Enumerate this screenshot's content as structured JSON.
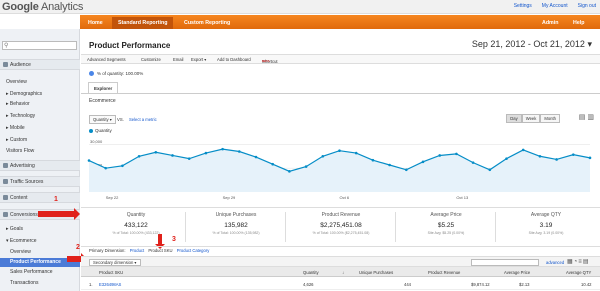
{
  "header": {
    "logo_google": "Google",
    "logo_analytics": "Analytics",
    "links": [
      "Settings",
      "My Account",
      "Sign out"
    ]
  },
  "nav": {
    "home": "Home",
    "standard_reporting": "Standard Reporting",
    "custom_reporting": "Custom Reporting",
    "admin": "Admin",
    "help": "Help"
  },
  "sidebar": {
    "audience": "Audience",
    "overview": "Overview",
    "demographics": "Demographics",
    "behavior": "Behavior",
    "technology": "Technology",
    "mobile": "Mobile",
    "custom": "Custom",
    "visitors_flow": "Visitors Flow",
    "advertising": "Advertising",
    "traffic_sources": "Traffic Sources",
    "content": "Content",
    "conversions": "Conversions",
    "goals": "Goals",
    "ecommerce": "Ecommerce",
    "ecom_overview": "Overview",
    "product_performance": "Product Performance",
    "sales_performance": "Sales Performance",
    "transactions": "Transactions"
  },
  "callouts": {
    "one": "1",
    "two": "2",
    "three": "3"
  },
  "main": {
    "title": "Product Performance",
    "date_range": "Sep 21, 2012 - Oct 21, 2012",
    "toolbar": [
      "Advanced Segments",
      "Customize",
      "Email",
      "Export ▾",
      "Add to Dashboard",
      "Shortcut"
    ],
    "shortcut_badge": "BETA",
    "segment": "% of quantity: 100.00%",
    "tab_explorer": "Explorer",
    "ecommerce": "Ecommerce",
    "metric_select": "Quantity ▾",
    "vs": "VS.",
    "select_metric": "Select a metric",
    "view_buttons": [
      "Day",
      "Week",
      "Month"
    ],
    "legend": "Quantity"
  },
  "chart_data": {
    "type": "area",
    "series": [
      {
        "name": "Quantity",
        "values": [
          19800,
          15000,
          16500,
          22500,
          25000,
          23000,
          21000,
          24500,
          27000,
          25500,
          22000,
          17500,
          13000,
          16000,
          22500,
          26000,
          24500,
          20000,
          17000,
          14000,
          19000,
          23000,
          24000,
          18500,
          14000,
          21000,
          26500,
          22500,
          20500,
          23500,
          21500
        ]
      }
    ],
    "x_ticks": [
      "Sep 22",
      "Sep 29",
      "Oct 6",
      "Oct 13"
    ],
    "y_ticks": [
      "30,000",
      "15,000"
    ],
    "ylim": [
      0,
      34000
    ],
    "color": "#058dc7"
  },
  "scorecards": [
    {
      "label": "Quantity",
      "value": "433,122",
      "sub": "% of Total: 100.00% (433,122)"
    },
    {
      "label": "Unique Purchases",
      "value": "135,982",
      "sub": "% of Total: 100.00% (135,982)"
    },
    {
      "label": "Product Revenue",
      "value": "$2,275,451.08",
      "sub": "% of Total: 100.00% ($2,275,451.08)"
    },
    {
      "label": "Average Price",
      "value": "$5.25",
      "sub": "Site Avg: $5.25 (0.00%)"
    },
    {
      "label": "Average QTY",
      "value": "3.19",
      "sub": "Site Avg: 3.19 (0.00%)"
    }
  ],
  "dims": {
    "label": "Primary Dimension:",
    "product": "Product",
    "sku": "Product SKU",
    "category": "Product Category"
  },
  "table": {
    "secondary_dimension": "Secondary dimension ▾",
    "advanced": "advanced",
    "headers": [
      "Product SKU",
      "Quantity",
      "↓",
      "Unique Purchases",
      "Product Revenue",
      "Average Price",
      "Average QTY"
    ],
    "rows": [
      {
        "num": "1.",
        "sku": "E326498AS",
        "quantity": "4,626",
        "unique": "444",
        "revenue": "$9,874.12",
        "avg_price": "$2.13",
        "avg_qty": "10.42"
      }
    ]
  }
}
